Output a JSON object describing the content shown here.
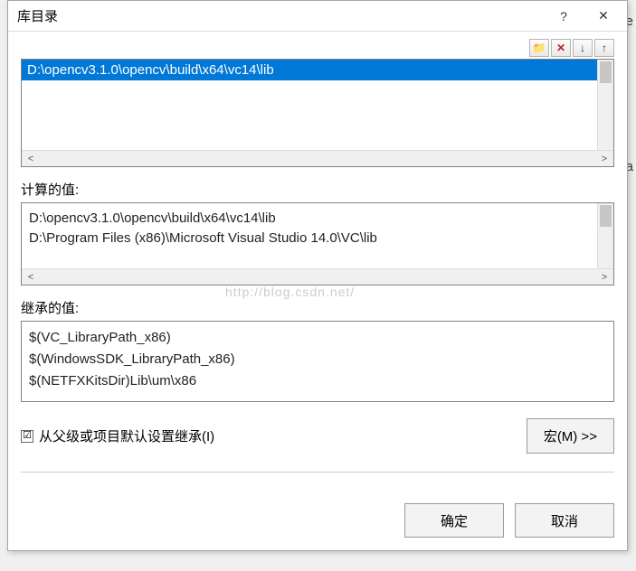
{
  "titlebar": {
    "title": "库目录"
  },
  "edit": {
    "selected_path": "D:\\opencv3.1.0\\opencv\\build\\x64\\vc14\\lib"
  },
  "computed": {
    "label": "计算的值:",
    "lines": [
      "D:\\opencv3.1.0\\opencv\\build\\x64\\vc14\\lib",
      "D:\\Program Files (x86)\\Microsoft Visual Studio 14.0\\VC\\lib"
    ]
  },
  "inherited": {
    "label": "继承的值:",
    "lines": [
      "$(VC_LibraryPath_x86)",
      "$(WindowsSDK_LibraryPath_x86)",
      "$(NETFXKitsDir)Lib\\um\\x86"
    ]
  },
  "inherit_check": {
    "label": "从父级或项目默认设置继承(I)",
    "checked": "☑"
  },
  "buttons": {
    "macro": "宏(M) >>",
    "ok": "确定",
    "cancel": "取消"
  },
  "watermark": "http://blog.csdn.net/"
}
